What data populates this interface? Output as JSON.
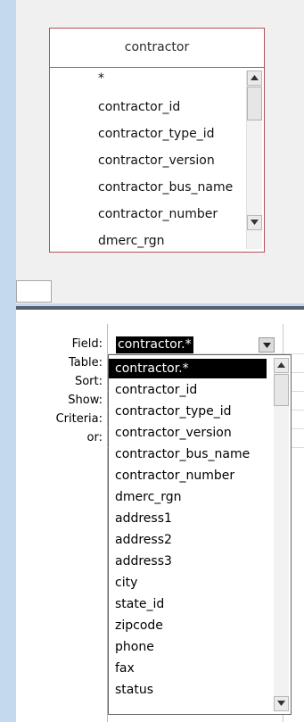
{
  "table": {
    "title": "contractor",
    "fields": [
      "*",
      "contractor_id",
      "contractor_type_id",
      "contractor_version",
      "contractor_bus_name",
      "contractor_number",
      "dmerc_rgn"
    ]
  },
  "grid": {
    "row_labels": [
      "Field:",
      "Table:",
      "Sort:",
      "Show:",
      "Criteria:",
      "or:"
    ],
    "field_value": "contractor.*"
  },
  "dropdown": {
    "selected_index": 0,
    "options": [
      "contractor.*",
      "contractor_id",
      "contractor_type_id",
      "contractor_version",
      "contractor_bus_name",
      "contractor_number",
      "dmerc_rgn",
      "address1",
      "address2",
      "address3",
      "city",
      "state_id",
      "zipcode",
      "phone",
      "fax",
      "status"
    ]
  },
  "icons": {
    "scroll_up": "arrow-up-icon",
    "scroll_down": "arrow-down-icon",
    "combo_dropdown": "chevron-down-icon"
  }
}
